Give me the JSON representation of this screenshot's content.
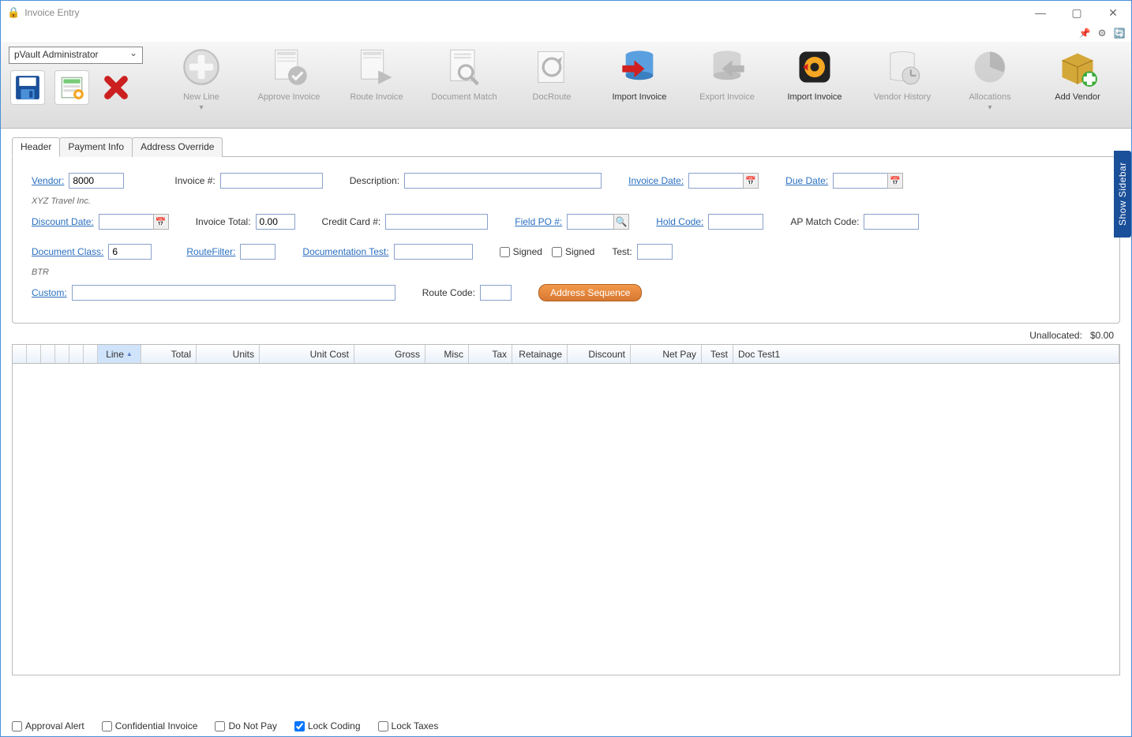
{
  "window": {
    "title": "Invoice Entry"
  },
  "user_selector": {
    "value": "pVault Administrator"
  },
  "ribbon": {
    "items": [
      {
        "label": "New Line",
        "enabled": false,
        "chev": true
      },
      {
        "label": "Approve Invoice",
        "enabled": false
      },
      {
        "label": "Route Invoice",
        "enabled": false
      },
      {
        "label": "Document Match",
        "enabled": false
      },
      {
        "label": "DocRoute",
        "enabled": false
      },
      {
        "label": "Import Invoice",
        "enabled": true
      },
      {
        "label": "Export Invoice",
        "enabled": false
      },
      {
        "label": "Import Invoice",
        "enabled": true
      },
      {
        "label": "Vendor History",
        "enabled": false
      },
      {
        "label": "Allocations",
        "enabled": false,
        "chev": true
      },
      {
        "label": "Add Vendor",
        "enabled": true
      }
    ]
  },
  "tabs": [
    "Header",
    "Payment Info",
    "Address Override"
  ],
  "header_form": {
    "vendor_label": "Vendor:",
    "vendor_value": "8000",
    "vendor_name": "XYZ Travel Inc.",
    "invoice_num_label": "Invoice #:",
    "invoice_num_value": "",
    "description_label": "Description:",
    "description_value": "",
    "invoice_date_label": "Invoice Date:",
    "invoice_date_value": "",
    "due_date_label": "Due Date:",
    "due_date_value": "",
    "discount_date_label": "Discount Date:",
    "discount_date_value": "",
    "invoice_total_label": "Invoice Total:",
    "invoice_total_value": "0.00",
    "credit_card_label": "Credit Card #:",
    "credit_card_value": "",
    "field_po_label": "Field PO #:",
    "field_po_value": "",
    "hold_code_label": "Hold Code:",
    "hold_code_value": "",
    "ap_match_label": "AP Match Code:",
    "ap_match_value": "",
    "doc_class_label": "Document Class:",
    "doc_class_value": "6",
    "doc_class_name": "BTR",
    "routefilter_label": "RouteFilter:",
    "routefilter_value": "",
    "doc_test_label": "Documentation Test:",
    "doc_test_value": "",
    "signed1_label": "Signed",
    "signed2_label": "Signed",
    "test_label": "Test:",
    "test_value": "",
    "custom_label": "Custom:",
    "custom_value": "",
    "route_code_label": "Route Code:",
    "route_code_value": "",
    "address_seq_btn": "Address Sequence"
  },
  "unallocated": {
    "label": "Unallocated:",
    "value": "$0.00"
  },
  "grid_columns": [
    "Line",
    "Total",
    "Units",
    "Unit Cost",
    "Gross",
    "Misc",
    "Tax",
    "Retainage",
    "Discount",
    "Net Pay",
    "Test",
    "Doc Test1"
  ],
  "footer": {
    "approval_alert": "Approval Alert",
    "confidential": "Confidential Invoice",
    "do_not_pay": "Do Not Pay",
    "lock_coding": "Lock Coding",
    "lock_coding_checked": true,
    "lock_taxes": "Lock Taxes"
  },
  "sidebar_tab": "Show Sidebar"
}
